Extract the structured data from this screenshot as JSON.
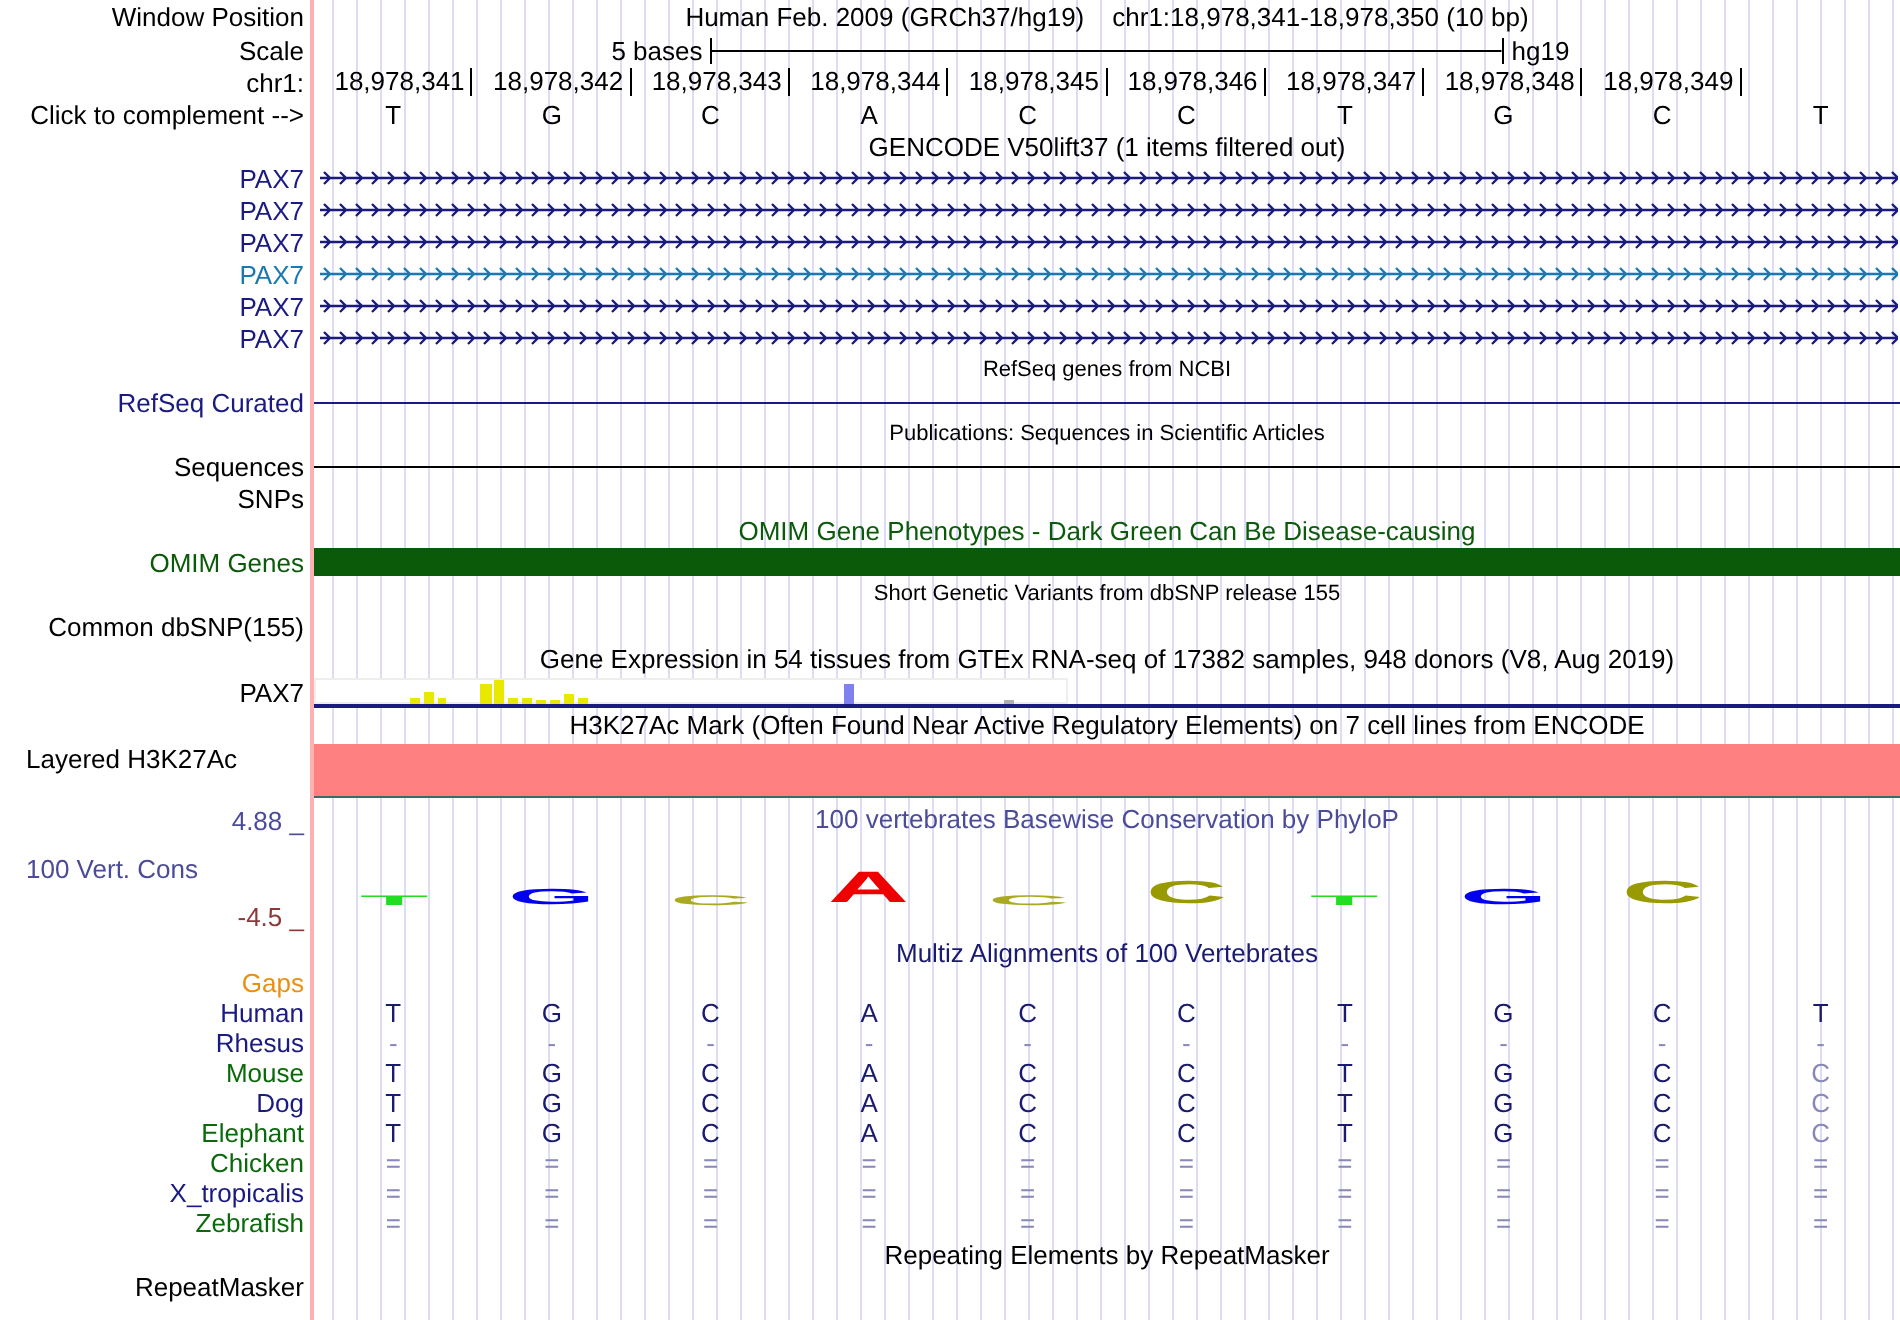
{
  "window_position": {
    "label": "Window Position",
    "assembly": "Human Feb. 2009 (GRCh37/hg19)",
    "range": "chr1:18,978,341-18,978,350 (10 bp)"
  },
  "scale": {
    "label": "Scale",
    "span": "5 bases",
    "assembly": "hg19"
  },
  "ruler": {
    "label": "chr1:",
    "positions": [
      "18,978,341",
      "18,978,342",
      "18,978,343",
      "18,978,344",
      "18,978,345",
      "18,978,346",
      "18,978,347",
      "18,978,348",
      "18,978,349"
    ]
  },
  "sequence": {
    "label": "Click to complement -->",
    "bases": [
      "T",
      "G",
      "C",
      "A",
      "C",
      "C",
      "T",
      "G",
      "C",
      "T"
    ]
  },
  "tracks": [
    {
      "kind": "genes",
      "title": "GENCODE V50lift37 (1 items filtered out)",
      "items": [
        {
          "label": "PAX7",
          "color": "#1a1a80"
        },
        {
          "label": "PAX7",
          "color": "#1a1a80"
        },
        {
          "label": "PAX7",
          "color": "#1a1a80"
        },
        {
          "label": "PAX7",
          "color": "#1a7ab0"
        },
        {
          "label": "PAX7",
          "color": "#1a1a80"
        },
        {
          "label": "PAX7",
          "color": "#1a1a80"
        }
      ]
    },
    {
      "kind": "line",
      "title": "RefSeq genes from NCBI",
      "label": "RefSeq Curated",
      "color": "#1a1a80"
    },
    {
      "kind": "line",
      "title": "Publications: Sequences in Scientific Articles",
      "label": "Sequences",
      "color": "#000000"
    },
    {
      "kind": "label",
      "label": "SNPs",
      "color": "#000000"
    },
    {
      "kind": "bar",
      "title": "OMIM Gene Phenotypes - Dark Green Can Be Disease-causing",
      "label": "OMIM Genes",
      "color": "#0a5a0a"
    },
    {
      "kind": "variants",
      "title": "Short Genetic Variants from dbSNP release 155",
      "label": "Common dbSNP(155)",
      "color": "#000000"
    },
    {
      "kind": "expression",
      "title": "Gene Expression in 54 tissues from GTEx RNA-seq of 17382 samples, 948 donors (V8, Aug 2019)",
      "label": "PAX7",
      "color": "#000000"
    },
    {
      "kind": "signal",
      "title": "H3K27Ac Mark (Often Found Near Active Regulatory Elements) on 7 cell lines from ENCODE",
      "label": "Layered H3K27Ac",
      "color": "#ff8080"
    },
    {
      "kind": "conservation",
      "title": "100 vertebrates Basewise Conservation by PhyloP",
      "label": "100 Vert. Cons",
      "max": "4.88 _",
      "min": "-4.5 _",
      "color": "#4b4b9a",
      "letters": [
        {
          "base": "T",
          "color": "#22dd22",
          "kind": "flat"
        },
        {
          "base": "G",
          "color": "#0000ee",
          "kind": "low"
        },
        {
          "base": "C",
          "color": "#aaaa22",
          "kind": "flat"
        },
        {
          "base": "A",
          "color": "#ee0000",
          "kind": "tall"
        },
        {
          "base": "C",
          "color": "#aaaa22",
          "kind": "flat"
        },
        {
          "base": "C",
          "color": "#999900",
          "kind": "medium"
        },
        {
          "base": "T",
          "color": "#22dd22",
          "kind": "flat"
        },
        {
          "base": "G",
          "color": "#0000ee",
          "kind": "low"
        },
        {
          "base": "C",
          "color": "#999900",
          "kind": "medium"
        }
      ]
    },
    {
      "kind": "alignment",
      "title": "Multiz Alignments of 100 Vertebrates",
      "gaps": "Gaps",
      "color": "#1a1a6e",
      "species": [
        {
          "label": "Human",
          "color": "#1a1a80",
          "cells": [
            {
              "b": "T",
              "dim": false
            },
            {
              "b": "G",
              "dim": false
            },
            {
              "b": "C",
              "dim": false
            },
            {
              "b": "A",
              "dim": false
            },
            {
              "b": "C",
              "dim": false
            },
            {
              "b": "C",
              "dim": false
            },
            {
              "b": "T",
              "dim": false
            },
            {
              "b": "G",
              "dim": false
            },
            {
              "b": "C",
              "dim": false
            },
            {
              "b": "T",
              "dim": false
            }
          ]
        },
        {
          "label": "Rhesus",
          "color": "#1a1a80",
          "cells": [
            {
              "b": "-",
              "dim": true
            },
            {
              "b": "-",
              "dim": true
            },
            {
              "b": "-",
              "dim": true
            },
            {
              "b": "-",
              "dim": true
            },
            {
              "b": "-",
              "dim": true
            },
            {
              "b": "-",
              "dim": true
            },
            {
              "b": "-",
              "dim": true
            },
            {
              "b": "-",
              "dim": true
            },
            {
              "b": "-",
              "dim": true
            },
            {
              "b": "-",
              "dim": true
            }
          ]
        },
        {
          "label": "Mouse",
          "color": "#0a6a0a",
          "cells": [
            {
              "b": "T",
              "dim": false
            },
            {
              "b": "G",
              "dim": false
            },
            {
              "b": "C",
              "dim": false
            },
            {
              "b": "A",
              "dim": false
            },
            {
              "b": "C",
              "dim": false
            },
            {
              "b": "C",
              "dim": false
            },
            {
              "b": "T",
              "dim": false
            },
            {
              "b": "G",
              "dim": false
            },
            {
              "b": "C",
              "dim": false
            },
            {
              "b": "C",
              "dim": true
            }
          ]
        },
        {
          "label": "Dog",
          "color": "#1a1a80",
          "cells": [
            {
              "b": "T",
              "dim": false
            },
            {
              "b": "G",
              "dim": false
            },
            {
              "b": "C",
              "dim": false
            },
            {
              "b": "A",
              "dim": false
            },
            {
              "b": "C",
              "dim": false
            },
            {
              "b": "C",
              "dim": false
            },
            {
              "b": "T",
              "dim": false
            },
            {
              "b": "G",
              "dim": false
            },
            {
              "b": "C",
              "dim": false
            },
            {
              "b": "C",
              "dim": true
            }
          ]
        },
        {
          "label": "Elephant",
          "color": "#0a6a0a",
          "cells": [
            {
              "b": "T",
              "dim": false
            },
            {
              "b": "G",
              "dim": false
            },
            {
              "b": "C",
              "dim": false
            },
            {
              "b": "A",
              "dim": false
            },
            {
              "b": "C",
              "dim": false
            },
            {
              "b": "C",
              "dim": false
            },
            {
              "b": "T",
              "dim": false
            },
            {
              "b": "G",
              "dim": false
            },
            {
              "b": "C",
              "dim": false
            },
            {
              "b": "C",
              "dim": true
            }
          ]
        },
        {
          "label": "Chicken",
          "color": "#0a6a0a",
          "cells": [
            {
              "b": "=",
              "dim": true
            },
            {
              "b": "=",
              "dim": true
            },
            {
              "b": "=",
              "dim": true
            },
            {
              "b": "=",
              "dim": true
            },
            {
              "b": "=",
              "dim": true
            },
            {
              "b": "=",
              "dim": true
            },
            {
              "b": "=",
              "dim": true
            },
            {
              "b": "=",
              "dim": true
            },
            {
              "b": "=",
              "dim": true
            },
            {
              "b": "=",
              "dim": true
            }
          ]
        },
        {
          "label": "X_tropicalis",
          "color": "#1a1a80",
          "cells": [
            {
              "b": "=",
              "dim": true
            },
            {
              "b": "=",
              "dim": true
            },
            {
              "b": "=",
              "dim": true
            },
            {
              "b": "=",
              "dim": true
            },
            {
              "b": "=",
              "dim": true
            },
            {
              "b": "=",
              "dim": true
            },
            {
              "b": "=",
              "dim": true
            },
            {
              "b": "=",
              "dim": true
            },
            {
              "b": "=",
              "dim": true
            },
            {
              "b": "=",
              "dim": true
            }
          ]
        },
        {
          "label": "Zebrafish",
          "color": "#0a6a0a",
          "cells": [
            {
              "b": "=",
              "dim": true
            },
            {
              "b": "=",
              "dim": true
            },
            {
              "b": "=",
              "dim": true
            },
            {
              "b": "=",
              "dim": true
            },
            {
              "b": "=",
              "dim": true
            },
            {
              "b": "=",
              "dim": true
            },
            {
              "b": "=",
              "dim": true
            },
            {
              "b": "=",
              "dim": true
            },
            {
              "b": "=",
              "dim": true
            },
            {
              "b": "=",
              "dim": true
            }
          ]
        }
      ]
    },
    {
      "kind": "empty",
      "title": "Repeating Elements by RepeatMasker",
      "label": "RepeatMasker",
      "color": "#000000"
    }
  ]
}
